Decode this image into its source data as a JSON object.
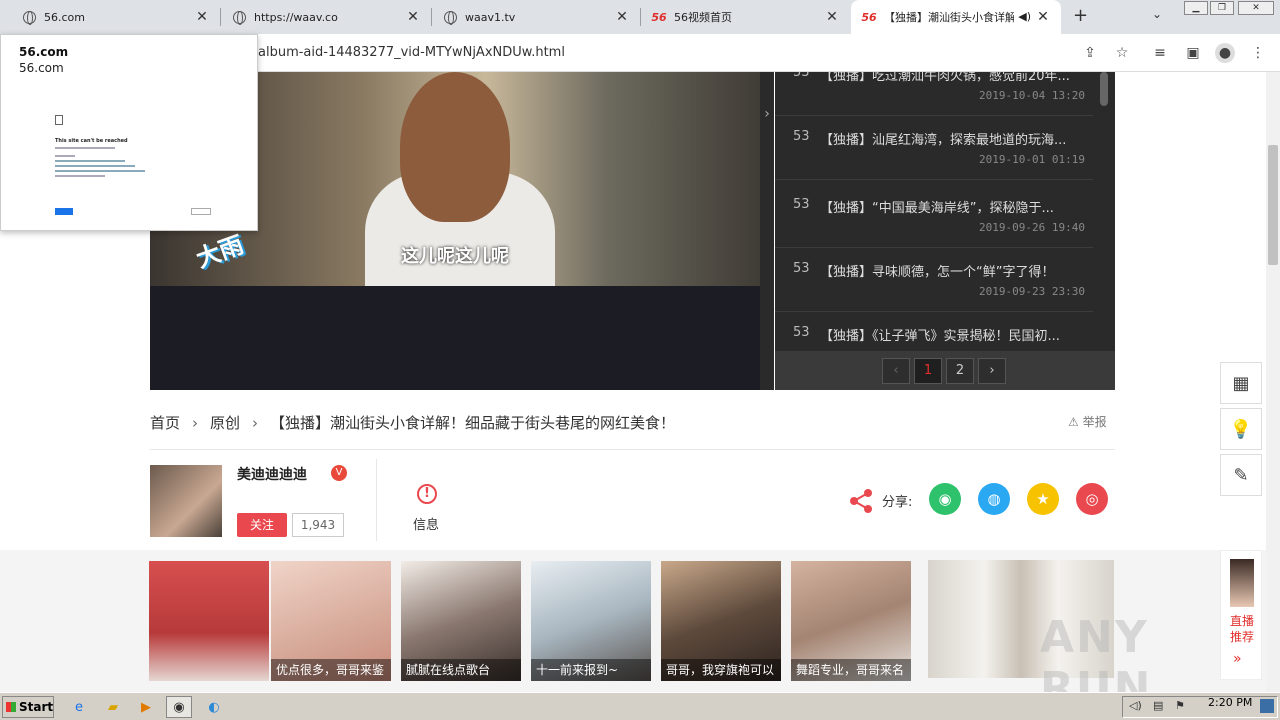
{
  "browser": {
    "tabs": [
      {
        "title": "56.com",
        "icon": "globe-icon"
      },
      {
        "title": "https://waav.co",
        "icon": "globe-icon"
      },
      {
        "title": "waav1.tv",
        "icon": "globe-icon"
      },
      {
        "title": "56视频首页",
        "icon": "56-logo"
      },
      {
        "title": "【独播】潮汕街头小食详解",
        "icon": "56-logo",
        "active": true
      }
    ],
    "logo_text": "56",
    "url": "album-aid-14483277_vid-MTYwNjAxNDUw.html"
  },
  "popup": {
    "title": "56.com",
    "subtitle": "56.com",
    "error_title": "This site can't be reached"
  },
  "video": {
    "subtitle": "这儿呢这儿呢",
    "stamp": "大雨"
  },
  "playlist": {
    "items": [
      {
        "num": "53",
        "title": "【独播】吃过潮汕牛肉火锅，感觉前20年...",
        "date": "2019-10-04 13:20"
      },
      {
        "num": "53",
        "title": "【独播】汕尾红海湾，探索最地道的玩海...",
        "date": "2019-10-01 01:19"
      },
      {
        "num": "53",
        "title": "【独播】“中国最美海岸线”，探秘隐于...",
        "date": "2019-09-26 19:40"
      },
      {
        "num": "53",
        "title": "【独播】寻味顺德，怎一个“鲜”字了得！",
        "date": "2019-09-23 23:30"
      },
      {
        "num": "53",
        "title": "【独播】《让子弹飞》实景揭秘！民国初...",
        "date": ""
      }
    ],
    "pages": [
      "1",
      "2"
    ],
    "current_page": "1"
  },
  "breadcrumb": {
    "home": "首页",
    "category": "原创",
    "title": "【独播】潮汕街头小食详解！细品藏于街头巷尾的网红美食！",
    "report": "举报"
  },
  "author": {
    "name": "美迪迪迪迪",
    "badge": "V",
    "follow_label": "关注",
    "followers": "1,943",
    "info_label": "信息"
  },
  "share": {
    "label": "分享:",
    "targets": [
      {
        "name": "wechat",
        "color": "#2dc26b",
        "glyph": "微"
      },
      {
        "name": "qq",
        "color": "#2aa8f2",
        "glyph": "Q"
      },
      {
        "name": "qzone",
        "color": "#f7c200",
        "glyph": "★"
      },
      {
        "name": "weibo",
        "color": "#e9484f",
        "glyph": "微"
      }
    ]
  },
  "recommend": [
    {
      "caption": "",
      "bg": "#c94a4a"
    },
    {
      "caption": "优点很多，哥哥来鉴",
      "bg": "#d9b8a8"
    },
    {
      "caption": "腻腻在线点歌台",
      "bg": "#6b5e55"
    },
    {
      "caption": "十一前来报到~",
      "bg": "#b8c4cc"
    },
    {
      "caption": "哥哥，我穿旗袍可以",
      "bg": "#8a7a6a"
    },
    {
      "caption": "舞蹈专业，哥哥来名",
      "bg": "#c8a48e"
    }
  ],
  "live": {
    "label": "直播推荐"
  },
  "watermark": "ANY RUN",
  "taskbar": {
    "start": "Start",
    "time": "2:20 PM"
  }
}
